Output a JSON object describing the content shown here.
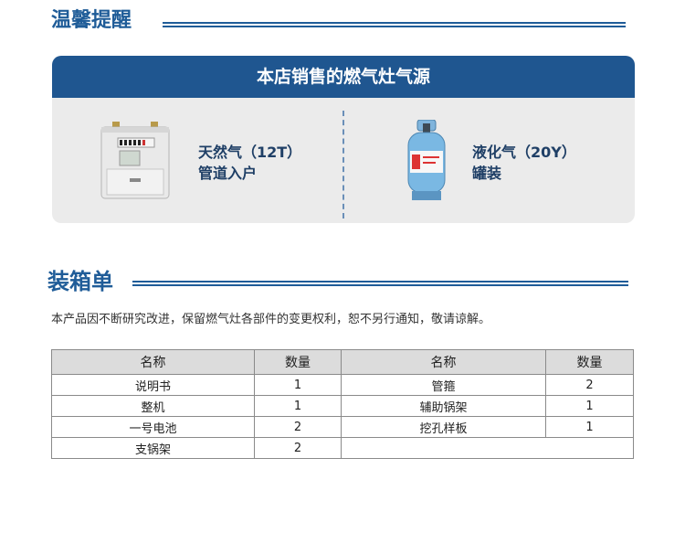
{
  "reminder": {
    "title": "温馨提醒",
    "card_title": "本店销售的燃气灶气源",
    "options": [
      {
        "name": "天然气（12T）",
        "desc": "管道入户",
        "icon": "gas-meter-icon"
      },
      {
        "name": "液化气（20Y）",
        "desc": "罐装",
        "icon": "gas-cylinder-icon"
      }
    ]
  },
  "packing": {
    "title": "装箱单",
    "note": "本产品因不断研究改进，保留燃气灶各部件的变更权利，恕不另行通知，敬请谅解。",
    "headers": [
      "名称",
      "数量",
      "名称",
      "数量"
    ],
    "rows": [
      [
        "说明书",
        "1",
        "管箍",
        "2"
      ],
      [
        "整机",
        "1",
        "辅助锅架",
        "1"
      ],
      [
        "一号电池",
        "2",
        "挖孔样板",
        "1"
      ],
      [
        "支锅架",
        "2",
        "",
        ""
      ]
    ]
  },
  "colors": {
    "accent": "#1f5690",
    "card_bg": "#ebebeb",
    "header_bg": "#dcdcdc"
  }
}
